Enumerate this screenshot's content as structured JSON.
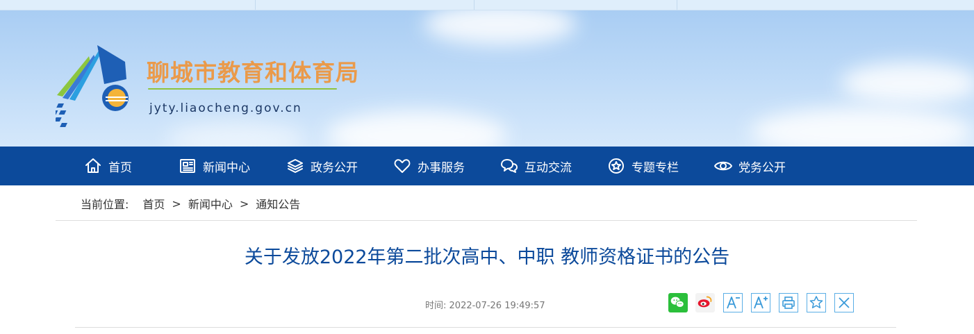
{
  "site": {
    "name": "聊城市教育和体育局",
    "domain": "jyty.liaocheng.gov.cn"
  },
  "nav": [
    {
      "label": "首页",
      "icon": "home-icon"
    },
    {
      "label": "新闻中心",
      "icon": "newspaper-icon"
    },
    {
      "label": "政务公开",
      "icon": "layers-icon"
    },
    {
      "label": "办事服务",
      "icon": "heart-icon"
    },
    {
      "label": "互动交流",
      "icon": "chat-icon"
    },
    {
      "label": "专题专栏",
      "icon": "star-circle-icon"
    },
    {
      "label": "党务公开",
      "icon": "eye-icon"
    }
  ],
  "breadcrumb": {
    "label": "当前位置:",
    "items": [
      "首页",
      "新闻中心",
      "通知公告"
    ],
    "separator": ">"
  },
  "article": {
    "title": "关于发放2022年第二批次高中、中职 教师资格证书的公告",
    "time_label": "时间:",
    "time_value": "2022-07-26 19:49:57"
  },
  "share_tools": [
    "wechat-icon",
    "weibo-icon",
    "font-decrease-icon",
    "font-increase-icon",
    "print-icon",
    "favorite-icon",
    "close-icon"
  ],
  "colors": {
    "nav_bg": "#0c4a9b",
    "title": "#0c4a9b",
    "site_name": "#ea9a4a",
    "tool_border": "#5aaee6"
  }
}
